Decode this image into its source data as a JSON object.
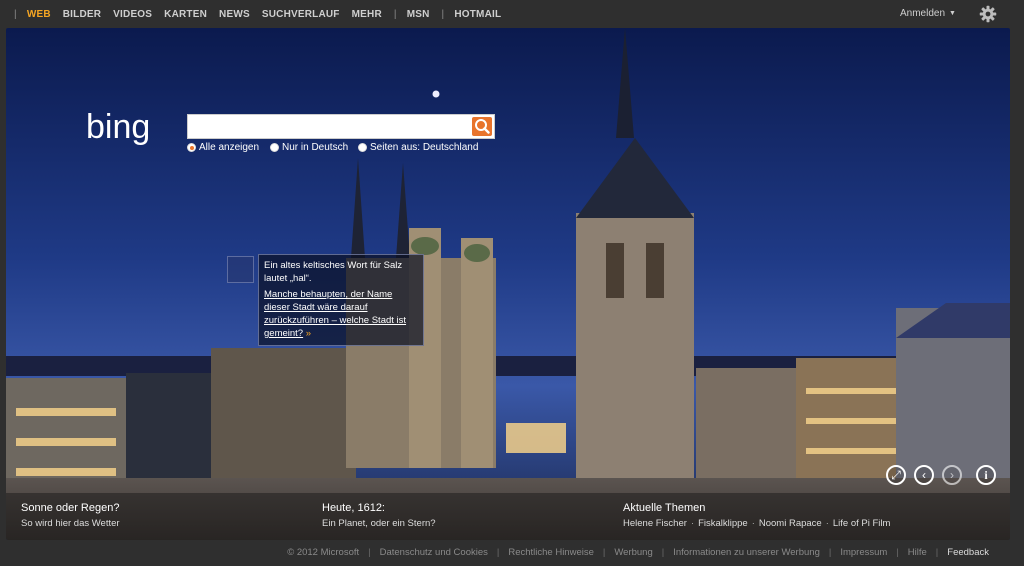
{
  "nav": {
    "items": [
      {
        "label": "WEB",
        "active": true
      },
      {
        "label": "BILDER"
      },
      {
        "label": "VIDEOS"
      },
      {
        "label": "KARTEN"
      },
      {
        "label": "NEWS"
      },
      {
        "label": "SUCHVERLAUF"
      },
      {
        "label": "MEHR"
      },
      {
        "label": "MSN"
      },
      {
        "label": "HOTMAIL"
      }
    ],
    "separator": "|",
    "signin": "Anmelden",
    "settings_icon": "gear-icon"
  },
  "logo": "bing",
  "search": {
    "value": "",
    "placeholder": "",
    "button_icon": "search-icon",
    "accent": "#e8742c"
  },
  "scope": [
    {
      "label": "Alle anzeigen",
      "checked": true
    },
    {
      "label": "Nur in Deutsch",
      "checked": false
    },
    {
      "label": "Seiten aus: Deutschland",
      "checked": false
    }
  ],
  "hotspot": {
    "line1": "Ein altes keltisches Wort für Salz lautet „hal“.",
    "link": "Manche behaupten, der Name dieser Stadt wäre darauf zurückzuführen – welche Stadt ist gemeint?",
    "more_icon": "»"
  },
  "panels": [
    {
      "title": "Sonne oder Regen?",
      "sub": "So wird hier das Wetter"
    },
    {
      "title": "Heute, 1612:",
      "sub": "Ein Planet, oder ein Stern?"
    },
    {
      "title": "Aktuelle Themen",
      "links": [
        "Helene Fischer",
        "Fiskalklippe",
        "Noomi Rapace",
        "Life of Pi Film"
      ],
      "sep": "·"
    }
  ],
  "hero_controls": [
    {
      "name": "fullscreen-icon",
      "glyph": "⤢"
    },
    {
      "name": "previous-icon",
      "glyph": "‹"
    },
    {
      "name": "next-icon",
      "glyph": "›"
    },
    {
      "name": "info-icon",
      "glyph": "i"
    }
  ],
  "footer": [
    "© 2012 Microsoft",
    "Datenschutz und Cookies",
    "Rechtliche Hinweise",
    "Werbung",
    "Informationen zu unserer Werbung",
    "Impressum",
    "Hilfe",
    "Feedback"
  ],
  "colors": {
    "nav_active": "#f5a623",
    "background": "#2f2f2f"
  }
}
